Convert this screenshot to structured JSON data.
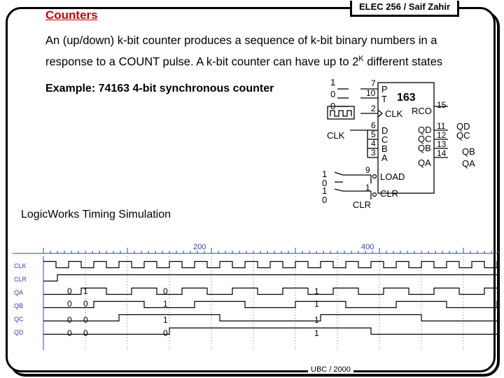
{
  "header": {
    "course": "ELEC 256 / Saif Zahir"
  },
  "slide": {
    "title": "Counters",
    "para_line1": "An (up/down) k-bit counter produces a sequence of k-bit binary numbers in a",
    "para_line2_a": "response to a COUNT pulse. A k-bit counter can have up to 2",
    "para_line2_sup": "K",
    "para_line2_b": " different states",
    "example": "Example: 74163 4-bit synchronous counter",
    "sim_title": "LogicWorks Timing Simulation",
    "footer": "UBC / 2000"
  },
  "circuit": {
    "switch_values": [
      "1",
      "0",
      "0"
    ],
    "clk_source_label": "CLK",
    "lower_switch_values": [
      "1",
      "0",
      "1",
      "0"
    ],
    "clr_source_label": "CLR",
    "chip_name": "163",
    "pin_nums": {
      "p": "7",
      "t": "10",
      "clk": "2",
      "d": "6",
      "c": "5",
      "b": "4",
      "a": "3",
      "load": "9",
      "clr": "1",
      "rco": "15",
      "qd": "11",
      "qc": "12",
      "qb": "13",
      "qa": "14"
    },
    "pins_left": {
      "p": "P",
      "t": "T",
      "clk": "CLK",
      "d": "D",
      "c": "C",
      "b": "B",
      "a": "A"
    },
    "pins_bottom": {
      "load": "LOAD",
      "clr": "CLR"
    },
    "pins_right": {
      "rco": "RCO",
      "qd": "QD",
      "qc": "QC",
      "qb": "QB",
      "qa": "QA"
    },
    "out_labels": [
      "QD",
      "QC",
      "QB",
      "QA"
    ]
  },
  "timing": {
    "ticks": [
      "200",
      "400"
    ],
    "signals": [
      "CLK",
      "CLR",
      "QA",
      "QB",
      "QC",
      "QD"
    ],
    "annotations": {
      "col1": [
        "0",
        "0",
        "0",
        "0"
      ],
      "col2": [
        "1",
        "0",
        "0",
        "0"
      ],
      "col3": [
        "0",
        "1",
        "1",
        "0"
      ],
      "col4": [
        "1",
        "1",
        "1",
        "1"
      ]
    },
    "colors": {
      "label": "#3344aa",
      "wave": "#000000",
      "grid": "#3344aa"
    }
  }
}
